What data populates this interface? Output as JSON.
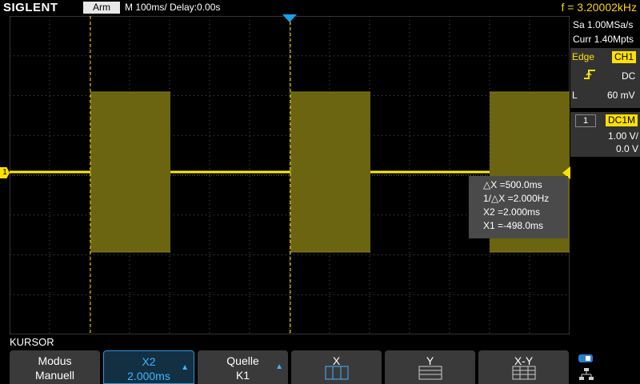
{
  "header": {
    "brand": "SIGLENT",
    "status": "Arm",
    "timebase": "M 100ms/  Delay:0.00s",
    "frequency": "f = 3.20002kHz"
  },
  "right_panel": {
    "sample_rate": "Sa 1.00MSa/s",
    "memory": "Curr 1.40Mpts",
    "trigger_type": "Edge",
    "trigger_source": "CH1",
    "coupling": "DC",
    "level_label": "L",
    "level_value": "60 mV",
    "channel_number": "1",
    "channel_coupling": "DC1M",
    "volts_div": "1.00 V/",
    "offset": "0.0 V"
  },
  "waveform": {
    "channel_marker": "1",
    "color": "#ffee00",
    "fill_color": "#6b6410"
  },
  "cursor_info": {
    "delta_x": "△X =500.0ms",
    "inv_delta_x": "1/△X =2.000Hz",
    "x2": "X2 =2.000ms",
    "x1": "X1 =-498.0ms"
  },
  "menu": {
    "title": "KURSOR",
    "buttons": [
      {
        "line1": "Modus",
        "line2": "Manuell"
      },
      {
        "line1": "X2",
        "line2": "2.000ms"
      },
      {
        "line1": "Quelle",
        "line2": "K1"
      },
      {
        "line1": "X",
        "line2": ""
      },
      {
        "line1": "Y",
        "line2": ""
      },
      {
        "line1": "X-Y",
        "line2": ""
      }
    ]
  },
  "colors": {
    "accent": "#2a9ad6",
    "channel": "#ffe000",
    "trigger_marker": "#1ea0e6"
  }
}
